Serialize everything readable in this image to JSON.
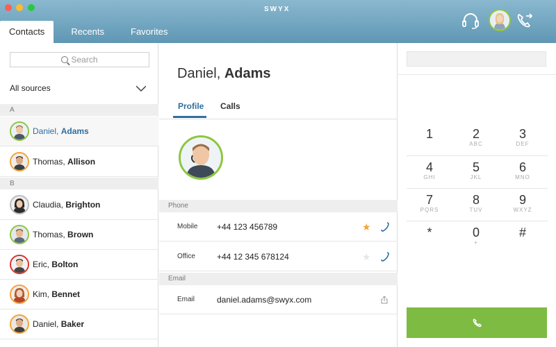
{
  "window": {
    "brand": "SWYX"
  },
  "tabs": [
    {
      "label": "Contacts",
      "active": true
    },
    {
      "label": "Recents",
      "active": false
    },
    {
      "label": "Favorites",
      "active": false
    }
  ],
  "header_icons": [
    "headset-icon",
    "user-avatar",
    "call-forward-icon"
  ],
  "sidebar": {
    "search_placeholder": "Search",
    "sources_label": "All sources",
    "sections": [
      {
        "letter": "A",
        "contacts": [
          {
            "first": "Daniel,",
            "last": "Adams",
            "selected": true,
            "ring": "#8cc63f"
          }
        ]
      },
      {
        "letter": "B",
        "contacts": [
          {
            "first": "Thomas,",
            "last": "Allison",
            "ring": "#f2a33a"
          },
          {
            "first": "Claudia,",
            "last": "Brighton",
            "ring": "#bbbbbb"
          },
          {
            "first": "Thomas,",
            "last": "Brown",
            "ring": "#8cc63f"
          },
          {
            "first": "Eric,",
            "last": "Bolton",
            "ring": "#d9322b"
          },
          {
            "first": "Kim,",
            "last": "Bennet",
            "ring": "#f2a33a"
          },
          {
            "first": "Daniel,",
            "last": "Baker",
            "ring": "#f2a33a"
          }
        ]
      }
    ]
  },
  "detail": {
    "first": "Daniel,",
    "last": "Adams",
    "tabs": [
      {
        "label": "Profile",
        "active": true
      },
      {
        "label": "Calls",
        "active": false
      }
    ],
    "phone_section": "Phone",
    "phones": [
      {
        "label": "Mobile",
        "value": "+44 123 456789",
        "favorite": true
      },
      {
        "label": "Office",
        "value": "+44 12 345 678124",
        "favorite": false
      }
    ],
    "email_section": "Email",
    "emails": [
      {
        "label": "Email",
        "value": "daniel.adams@swyx.com"
      }
    ]
  },
  "dialpad": {
    "keys": [
      {
        "digit": "1",
        "letters": ""
      },
      {
        "digit": "2",
        "letters": "ABC"
      },
      {
        "digit": "3",
        "letters": "DEF"
      },
      {
        "digit": "4",
        "letters": "GHI"
      },
      {
        "digit": "5",
        "letters": "JKL"
      },
      {
        "digit": "6",
        "letters": "MNO"
      },
      {
        "digit": "7",
        "letters": "PQRS"
      },
      {
        "digit": "8",
        "letters": "TUV"
      },
      {
        "digit": "9",
        "letters": "WXYZ"
      },
      {
        "digit": "*",
        "letters": ""
      },
      {
        "digit": "0",
        "letters": "+"
      },
      {
        "digit": "#",
        "letters": ""
      }
    ]
  },
  "colors": {
    "header": "#5f97b4",
    "accent": "#2e6f9e",
    "presence_green": "#8cc63f",
    "call_button": "#7dbb42",
    "favorite_star": "#f2a33a"
  }
}
